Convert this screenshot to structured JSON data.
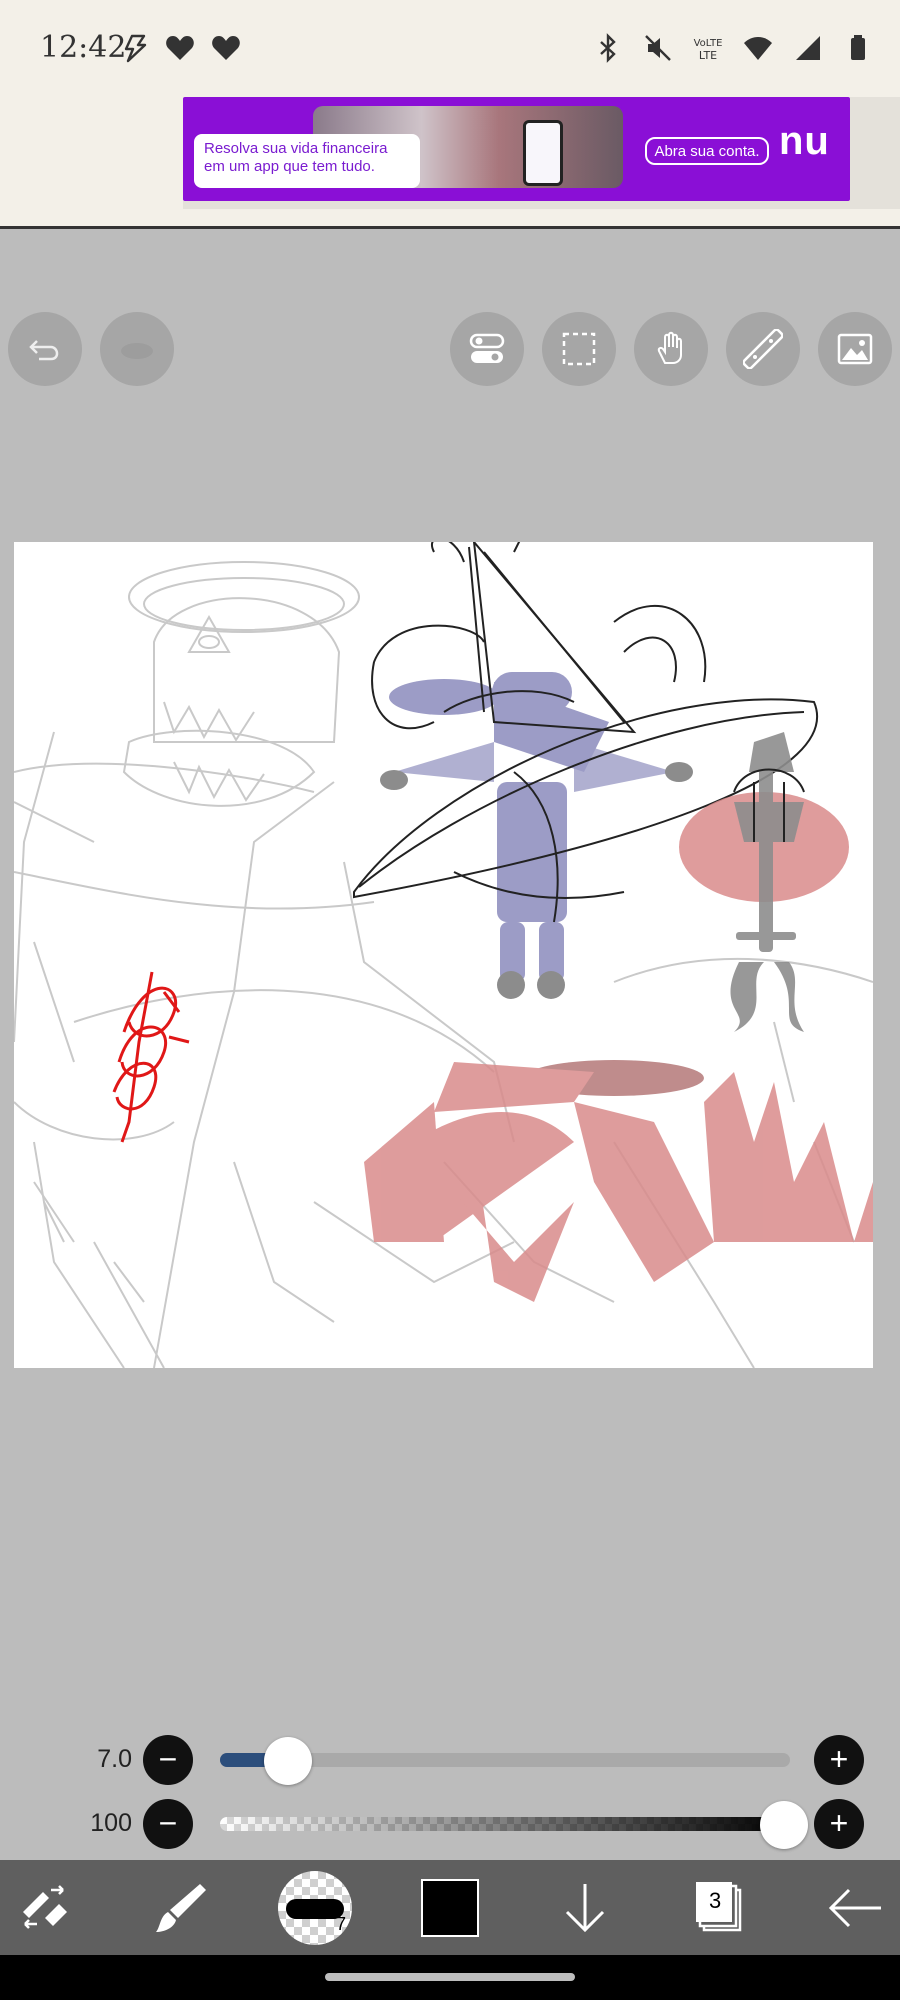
{
  "status_bar": {
    "time": "12:42",
    "left_icons": [
      "flash-icon",
      "heart-icon",
      "heart-icon"
    ],
    "right_icons": [
      "bluetooth-icon",
      "mute-icon",
      "volte-icon",
      "wifi-icon",
      "signal-icon",
      "battery-icon"
    ],
    "volte_label": "Vo)\nLTE"
  },
  "ad": {
    "text": "Resolva sua vida financeira em um app que tem tudo.",
    "button": "Abra sua conta.",
    "logo": "nu",
    "accent": "#8a0fd6"
  },
  "toolbar_top": {
    "left": [
      "undo-icon",
      "redo-icon"
    ],
    "right": [
      "toggle-icon",
      "selection-icon",
      "hand-icon",
      "ruler-icon",
      "image-icon"
    ]
  },
  "brush_size": {
    "label": "7.0",
    "level": 0.09
  },
  "opacity": {
    "label": "100",
    "level": 1.0
  },
  "bottom_toolbar": {
    "brush_badge": "7",
    "layers_count": "3",
    "color": "#000000"
  }
}
